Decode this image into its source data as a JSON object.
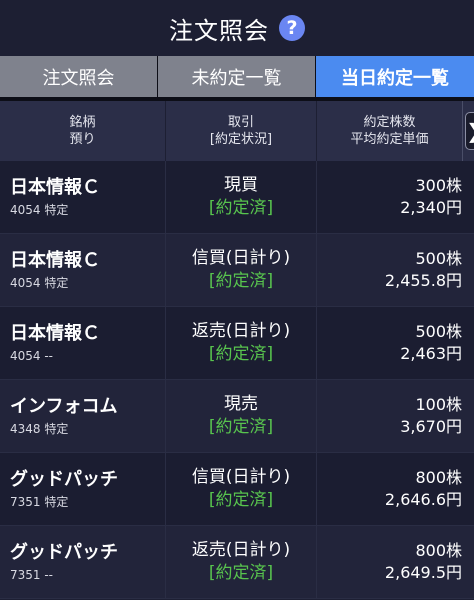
{
  "title": {
    "text": "注文照会",
    "help_icon": "?"
  },
  "tabs": [
    {
      "label": "注文照会"
    },
    {
      "label": "未約定一覧"
    },
    {
      "label": "当日約定一覧"
    }
  ],
  "header": {
    "col1_line1": "銘柄",
    "col1_line2": "預り",
    "col2_line1": "取引",
    "col2_line2": "[約定状況]",
    "col3_line1": "約定株数",
    "col3_line2": "平均約定単価",
    "scroll_glyph": "❯"
  },
  "rows": [
    {
      "name": "日本情報Ｃ",
      "sub": "4054 特定",
      "type": "現買",
      "status": "[約定済]",
      "qty": "300株",
      "price": "2,340円"
    },
    {
      "name": "日本情報Ｃ",
      "sub": "4054 特定",
      "type": "信買(日計り)",
      "status": "[約定済]",
      "qty": "500株",
      "price": "2,455.8円"
    },
    {
      "name": "日本情報Ｃ",
      "sub": "4054 --",
      "type": "返売(日計り)",
      "status": "[約定済]",
      "qty": "500株",
      "price": "2,463円"
    },
    {
      "name": "インフォコム",
      "sub": "4348 特定",
      "type": "現売",
      "status": "[約定済]",
      "qty": "100株",
      "price": "3,670円"
    },
    {
      "name": "グッドパッチ",
      "sub": "7351 特定",
      "type": "信買(日計り)",
      "status": "[約定済]",
      "qty": "800株",
      "price": "2,646.6円"
    },
    {
      "name": "グッドパッチ",
      "sub": "7351 --",
      "type": "返売(日計り)",
      "status": "[約定済]",
      "qty": "800株",
      "price": "2,649.5円"
    }
  ],
  "colors": {
    "accent": "#4b8bf0",
    "status_green": "#58c44e",
    "help": "#6a86f2"
  }
}
